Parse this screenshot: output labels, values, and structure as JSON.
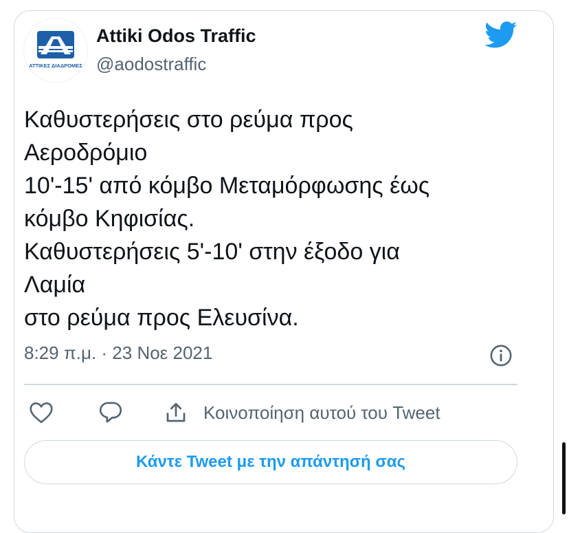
{
  "account": {
    "name": "Attiki Odos Traffic",
    "handle": "@aodostraffic",
    "logo_caption": "ΑΤΤΙΚΕΣ ΔΙΑΔΡΟΜΕΣ"
  },
  "tweet": {
    "text": "Καθυστερήσεις στο ρεύμα προς\nΑεροδρόμιο\n10'-15' από κόμβο Μεταμόρφωσης έως\nκόμβο Κηφισίας.\nΚαθυστερήσεις 5'-10' στην έξοδο για\nΛαμία\nστο ρεύμα προς Ελευσίνα.",
    "timestamp": "8:29 π.μ. · 23 Νοε 2021"
  },
  "actions": {
    "share_label": "Κοινοποίηση αυτού του Tweet",
    "reply_button_label": "Κάντε Tweet με την απάντησή σας"
  },
  "icons": {
    "like": "heart-icon",
    "reply": "reply-bubble-icon",
    "share": "share-icon",
    "info": "info-icon",
    "brand": "twitter-bird-icon"
  },
  "colors": {
    "twitter_blue": "#1d9bf0",
    "logo_blue": "#1d5fa8",
    "text_primary": "#0f1419",
    "text_secondary": "#536471",
    "border": "#cfd9de"
  }
}
